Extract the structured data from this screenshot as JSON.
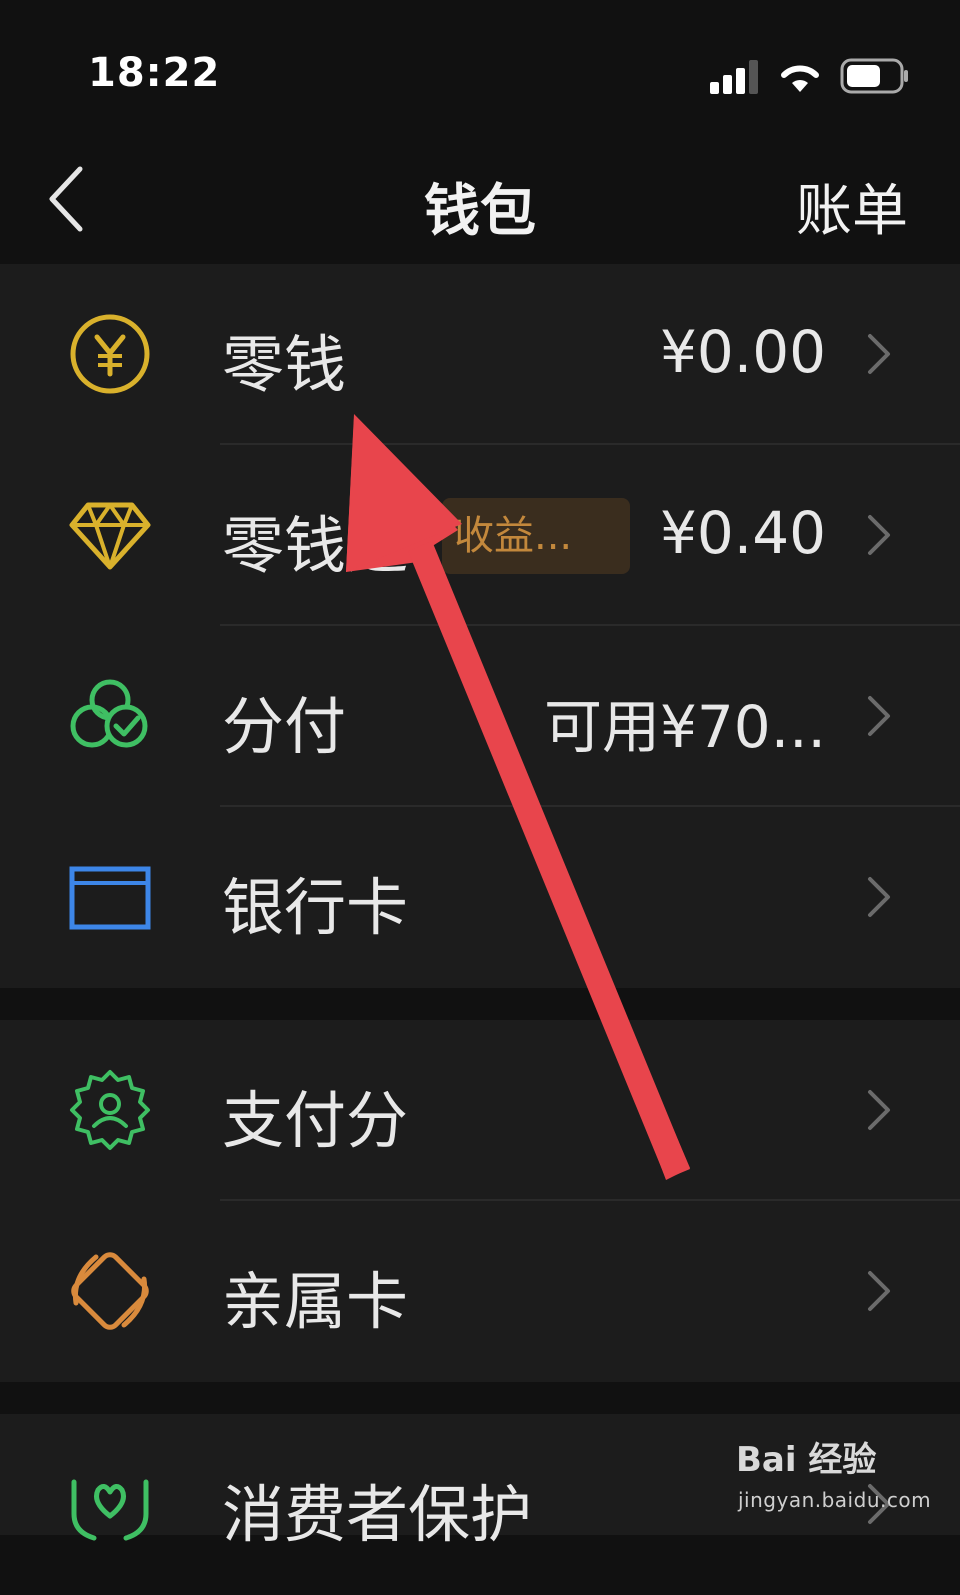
{
  "status_bar": {
    "time": "18:22",
    "icons": [
      "cellular-signal-icon",
      "wifi-icon",
      "battery-icon"
    ]
  },
  "nav": {
    "back_icon": "chevron-left-icon",
    "title": "钱包",
    "right_label": "账单"
  },
  "groups": [
    {
      "items": [
        {
          "label": "零钱",
          "value": "¥0.00",
          "icon": "yuan-coin-icon",
          "icon_color": "#d9b12c"
        },
        {
          "label": "零钱通",
          "badge": "收益...",
          "value": "¥0.40",
          "icon": "diamond-icon",
          "icon_color": "#d9b12c"
        },
        {
          "label": "分付",
          "value": "可用¥70...",
          "icon": "fenfu-icon",
          "icon_color": "#3fbf63"
        },
        {
          "label": "银行卡",
          "value": "",
          "icon": "bank-card-icon",
          "icon_color": "#3d86e8"
        }
      ]
    },
    {
      "items": [
        {
          "label": "支付分",
          "value": "",
          "icon": "payscore-badge-icon",
          "icon_color": "#3fbf63"
        },
        {
          "label": "亲属卡",
          "value": "",
          "icon": "family-card-icon",
          "icon_color": "#d98a3c"
        }
      ]
    },
    {
      "items": [
        {
          "label": "消费者保护",
          "value": "",
          "icon": "consumer-protection-icon",
          "icon_color": "#3fbf63"
        }
      ]
    }
  ],
  "annotation": {
    "arrow_color": "#e8454c"
  },
  "watermark": {
    "brand": "Bai 经验",
    "url": "jingyan.baidu.com"
  }
}
